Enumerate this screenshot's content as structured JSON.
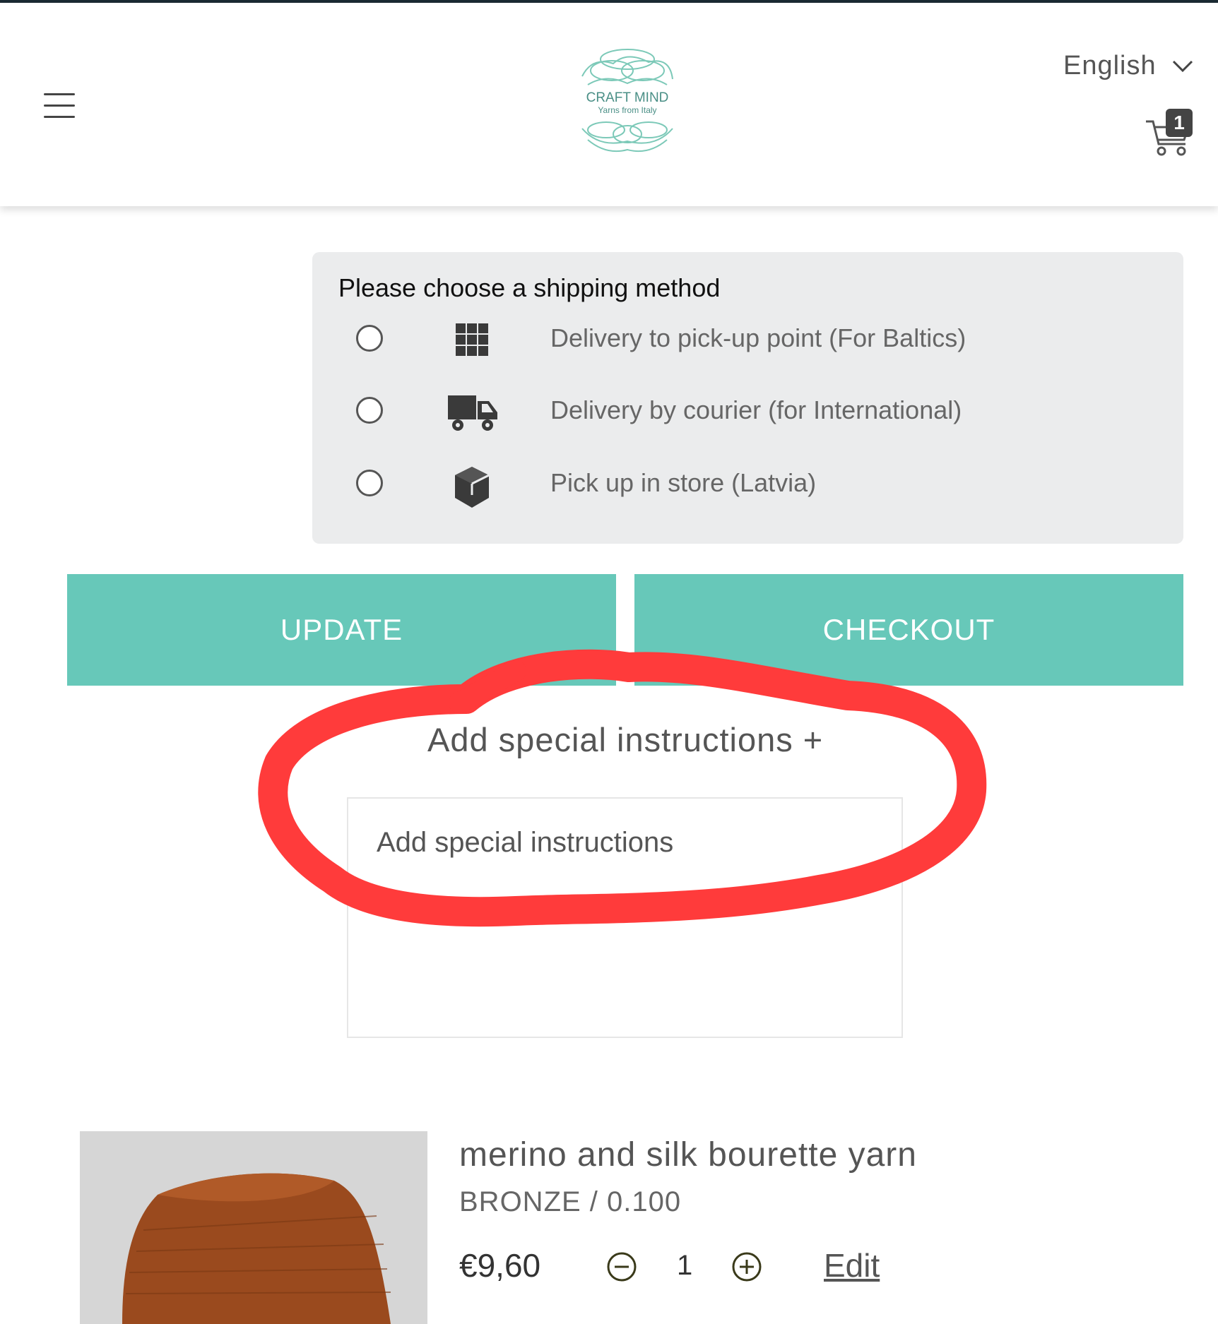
{
  "header": {
    "logo_text": "CRAFT MIND",
    "logo_subtext": "Yarns from Italy",
    "language": "English",
    "cart_count": "1"
  },
  "shipping": {
    "title": "Please choose a shipping method",
    "options": [
      {
        "label": "Delivery to pick-up point (For Baltics)",
        "icon": "grid-icon",
        "selected": false
      },
      {
        "label": "Delivery by courier (for International)",
        "icon": "truck-icon",
        "selected": false
      },
      {
        "label": "Pick up in store (Latvia)",
        "icon": "box-icon",
        "selected": false
      }
    ]
  },
  "actions": {
    "update_label": "UPDATE",
    "checkout_label": "CHECKOUT"
  },
  "instructions": {
    "toggle_label": "Add special instructions +",
    "placeholder": "Add special instructions",
    "value": ""
  },
  "product": {
    "name": "merino and silk bourette yarn",
    "variant": "BRONZE / 0.100",
    "price": "€9,60",
    "quantity": "1",
    "edit_label": "Edit"
  },
  "colors": {
    "accent": "#67c8b9",
    "annotation": "#ff3b3b",
    "ship_box_bg": "#ebeced"
  }
}
